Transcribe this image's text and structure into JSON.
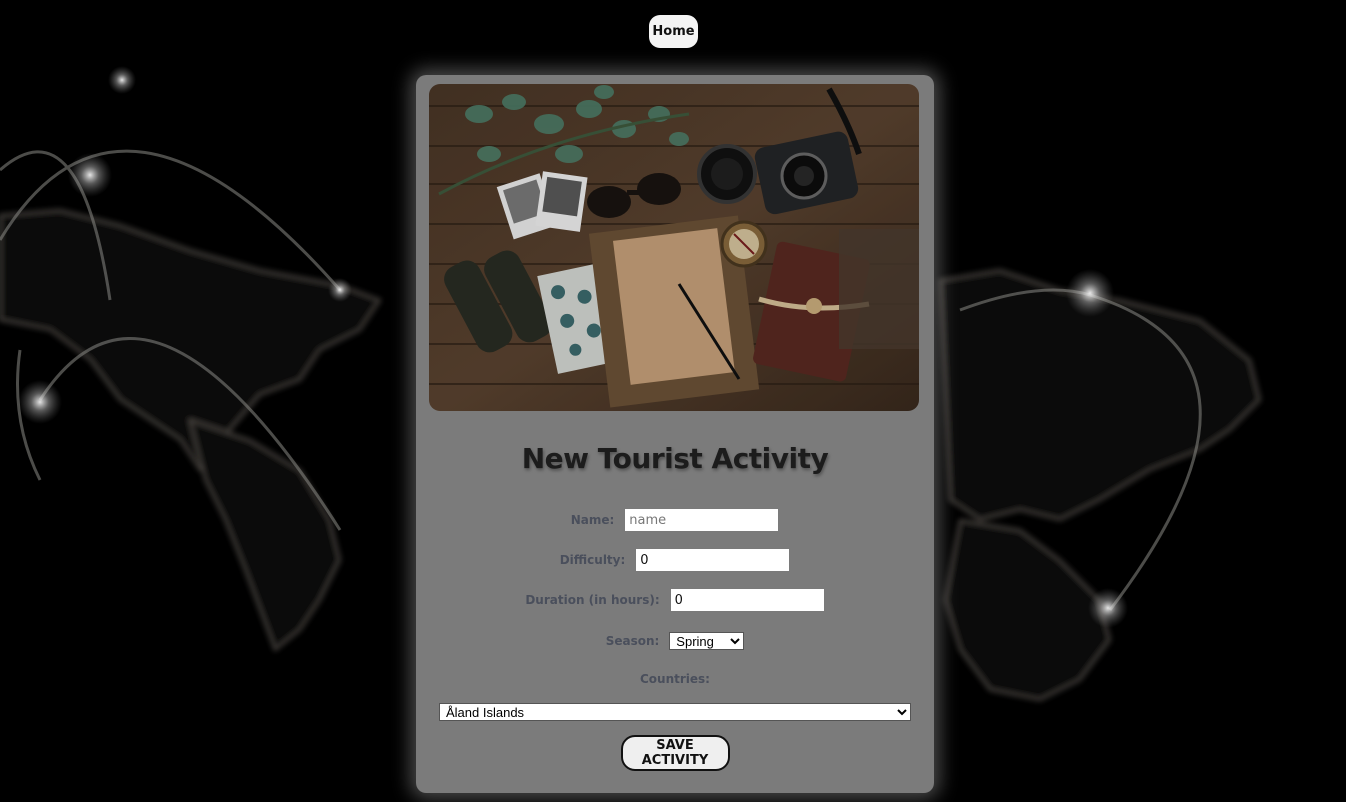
{
  "nav": {
    "home_label": "Home"
  },
  "form": {
    "title": "New Tourist Activity",
    "name_label": "Name:",
    "name_placeholder": "name",
    "name_value": "",
    "difficulty_label": "Difficulty:",
    "difficulty_value": "0",
    "duration_label": "Duration (in hours):",
    "duration_value": "0",
    "season_label": "Season:",
    "season_value": "Spring",
    "countries_label": "Countries:",
    "countries_value": "Åland Islands",
    "save_label": "SAVE ACTIVITY"
  },
  "colors": {
    "background": "#000000",
    "card": "#969696",
    "button": "#f4f4f4",
    "label": "#4a4f5c"
  }
}
